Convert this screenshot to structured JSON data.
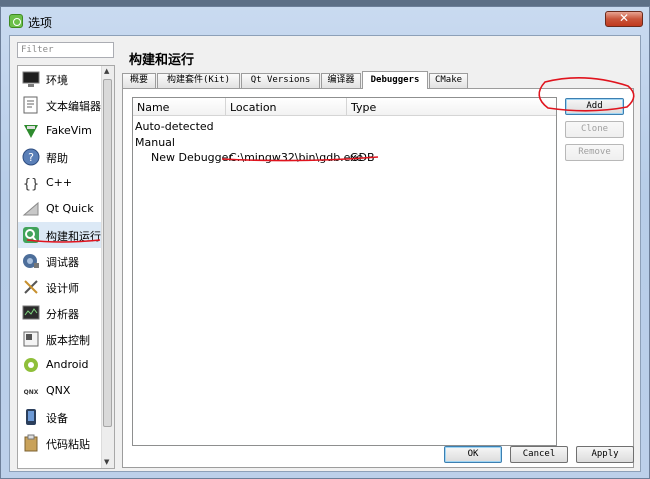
{
  "window": {
    "title": "选项"
  },
  "filter": {
    "placeholder": "Filter"
  },
  "sidebar": {
    "items": [
      {
        "label": "环境",
        "icon": "monitor-icon"
      },
      {
        "label": "文本编辑器",
        "icon": "text-editor-icon"
      },
      {
        "label": "FakeVim",
        "icon": "fakevim-icon"
      },
      {
        "label": "帮助",
        "icon": "help-icon"
      },
      {
        "label": "C++",
        "icon": "cpp-braces-icon"
      },
      {
        "label": "Qt Quick",
        "icon": "qt-quick-icon"
      },
      {
        "label": "构建和运行",
        "icon": "build-run-icon"
      },
      {
        "label": "调试器",
        "icon": "debugger-icon"
      },
      {
        "label": "设计师",
        "icon": "designer-icon"
      },
      {
        "label": "分析器",
        "icon": "analyzer-icon"
      },
      {
        "label": "版本控制",
        "icon": "version-control-icon"
      },
      {
        "label": "Android",
        "icon": "android-icon"
      },
      {
        "label": "QNX",
        "icon": "qnx-icon"
      },
      {
        "label": "设备",
        "icon": "device-icon"
      },
      {
        "label": "代码粘贴",
        "icon": "code-paste-icon"
      }
    ],
    "selected": "构建和运行"
  },
  "page": {
    "title": "构建和运行"
  },
  "tabs": [
    {
      "label": "概要"
    },
    {
      "label": "构建套件(Kit)"
    },
    {
      "label": "Qt Versions"
    },
    {
      "label": "编译器"
    },
    {
      "label": "Debuggers"
    },
    {
      "label": "CMake"
    }
  ],
  "active_tab": "Debuggers",
  "table": {
    "columns": [
      "Name",
      "Location",
      "Type"
    ],
    "groups": [
      {
        "label": "Auto-detected"
      },
      {
        "label": "Manual",
        "children": [
          {
            "name": "New Debugger",
            "location": "C:\\mingw32\\bin\\gdb.exe",
            "type": "GDB"
          }
        ]
      }
    ]
  },
  "side_buttons": {
    "add": "Add",
    "clone": "Clone",
    "remove": "Remove"
  },
  "dialog_buttons": {
    "ok": "OK",
    "cancel": "Cancel",
    "apply": "Apply"
  },
  "colors": {
    "annotation": "#e0141e",
    "selection": "#dce9f6",
    "title_bar": "#bcd0ea"
  }
}
